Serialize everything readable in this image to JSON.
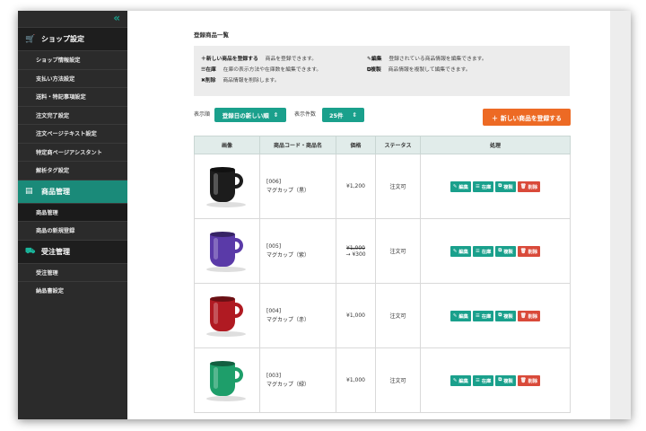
{
  "sidebar": {
    "collapse_glyph": "«",
    "sections": [
      {
        "label": "ショップ設定",
        "icon": "cart-icon",
        "active": false,
        "items": [
          {
            "label": "ショップ情報設定"
          },
          {
            "label": "支払い方法設定"
          },
          {
            "label": "送料・特記事項設定"
          },
          {
            "label": "注文完了設定"
          },
          {
            "label": "注文ページテキスト設定"
          },
          {
            "label": "特定商ページアシスタント"
          },
          {
            "label": "解析タグ設定"
          }
        ]
      },
      {
        "label": "商品管理",
        "icon": "box-icon",
        "active": true,
        "items": [
          {
            "label": "商品管理",
            "current": true
          },
          {
            "label": "商品の新規登録"
          }
        ]
      },
      {
        "label": "受注管理",
        "icon": "truck-icon",
        "active": false,
        "items": [
          {
            "label": "受注管理"
          },
          {
            "label": "納品書設定"
          }
        ]
      }
    ]
  },
  "page": {
    "title": "登録商品一覧",
    "info": {
      "register_label": "新しい商品を登録する",
      "register_desc": "商品を登録できます。",
      "edit_label": "編集",
      "edit_desc": "登録されている商品情報を編集できます。",
      "stock_label": "在庫",
      "stock_desc": "在庫の表示方法や在庫数を編集できます。",
      "copy_label": "複製",
      "copy_desc": "商品情報を複製して編集できます。",
      "delete_label": "削除",
      "delete_desc": "商品情報を削除します。"
    },
    "controls": {
      "sort_label": "表示順",
      "sort_value": "登録日の新しい順",
      "count_label": "表示件数",
      "count_value": "25件",
      "add_button": "新しい商品を登録する"
    },
    "table": {
      "headers": {
        "image": "画像",
        "code": "商品コード・商品名",
        "price": "価格",
        "status": "ステータス",
        "actions": "処理"
      },
      "rows": [
        {
          "code": "[006]",
          "name": "マグカップ（黒）",
          "price": "¥1,200",
          "old_price": "",
          "status": "注文可",
          "color": "#1c1c1c"
        },
        {
          "code": "[005]",
          "name": "マグカップ（紫）",
          "price": "→ ¥300",
          "old_price": "¥1,000",
          "status": "注文可",
          "color": "#5a3aa8"
        },
        {
          "code": "[004]",
          "name": "マグカップ（赤）",
          "price": "¥1,000",
          "old_price": "",
          "status": "注文可",
          "color": "#b01a22"
        },
        {
          "code": "[003]",
          "name": "マグカップ（緑）",
          "price": "¥1,000",
          "old_price": "",
          "status": "注文可",
          "color": "#1e9e6a"
        }
      ],
      "actions": {
        "edit": "編集",
        "stock": "在庫",
        "copy": "複製",
        "delete": "削除"
      }
    }
  }
}
